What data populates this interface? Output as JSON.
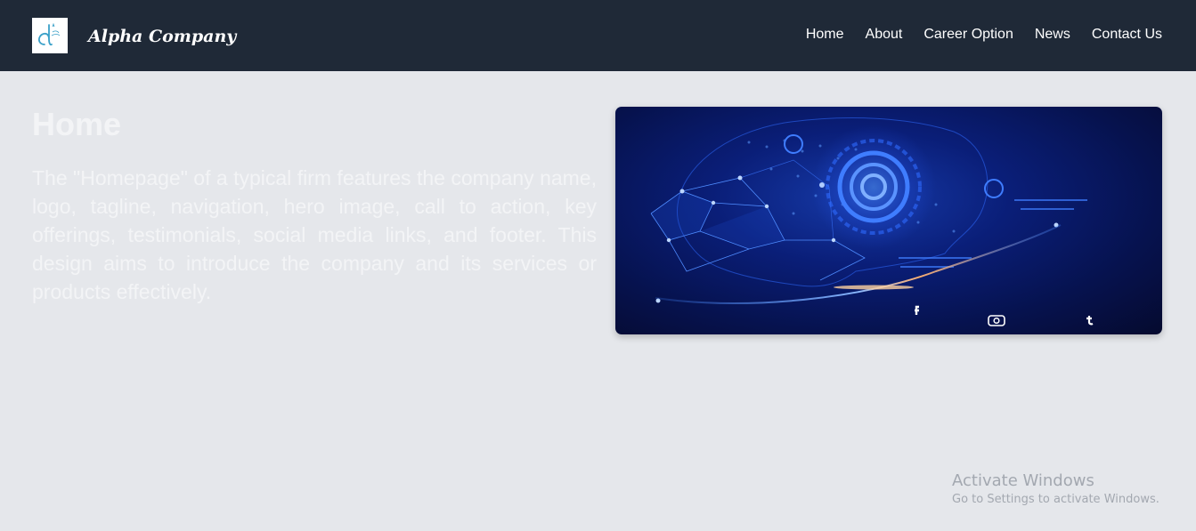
{
  "header": {
    "brand": "Alpha Company",
    "logo_text": "Alpha Company",
    "nav": [
      {
        "label": "Home"
      },
      {
        "label": "About"
      },
      {
        "label": "Career Option"
      },
      {
        "label": "News"
      },
      {
        "label": "Contact Us"
      }
    ]
  },
  "main": {
    "title": "Home",
    "description": "The \"Homepage\" of a typical firm features the company name, logo, tagline, navigation, hero image, call to action, key offerings, testimonials, social media links, and footer. This design aims to introduce the company and its services or products effectively."
  },
  "hero_image": {
    "social_icons": [
      "facebook-icon",
      "instagram-icon",
      "tumblr-icon"
    ]
  },
  "watermark": {
    "title": "Activate Windows",
    "subtitle": "Go to Settings to activate Windows."
  },
  "colors": {
    "navbar": "#1f2937",
    "page_background": "#e5e7eb",
    "nav_text": "#ffffff"
  }
}
